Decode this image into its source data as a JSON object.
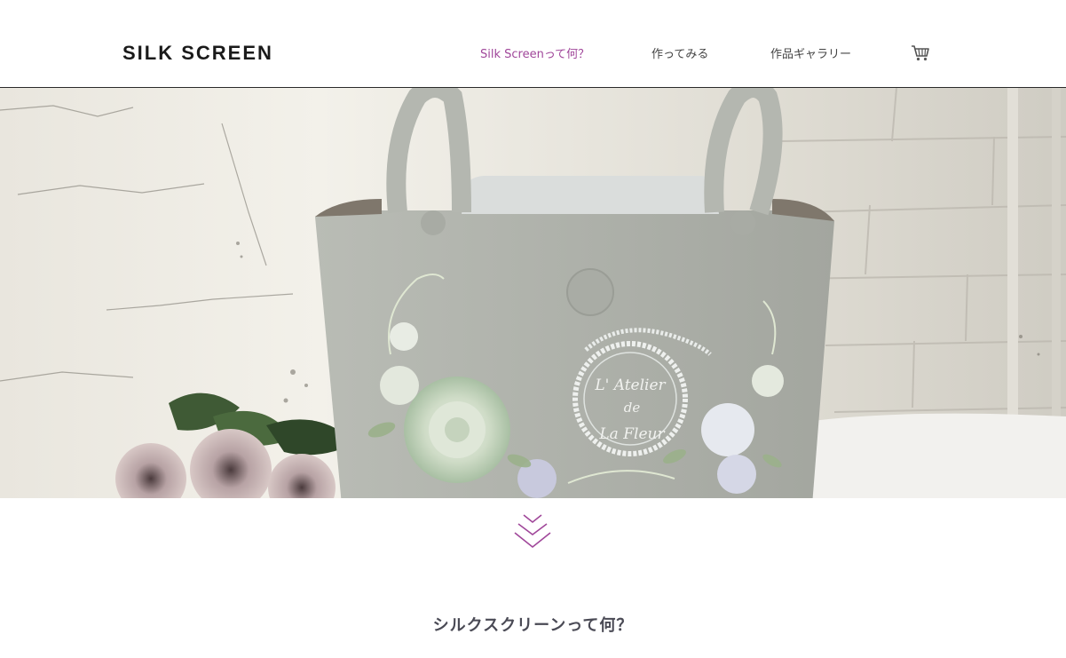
{
  "header": {
    "logo": "SILK SCREEN",
    "nav": [
      {
        "label": "Silk Screenって何？",
        "active": true
      },
      {
        "label": "作ってみる",
        "active": false
      },
      {
        "label": "作品ギャラリー",
        "active": false
      }
    ],
    "cart_icon": "shopping-cart-icon"
  },
  "hero": {
    "bag_print": [
      "L' Atelier",
      "de",
      "La Fleur"
    ]
  },
  "scroll_icon": "chevron-down-icon",
  "section": {
    "title": "シルクスクリーンって何？"
  },
  "colors": {
    "accent": "#a0479a",
    "nav_text": "#444444",
    "title_text": "#4a4a55"
  }
}
